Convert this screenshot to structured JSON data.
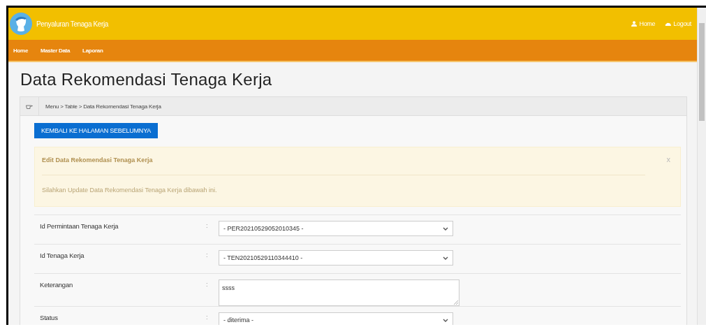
{
  "header": {
    "title": "Penyaluran Tenaga Kerja",
    "links": [
      {
        "label": "Home"
      },
      {
        "label": "Logout"
      }
    ]
  },
  "nav": {
    "items": [
      "Home",
      "Master Data",
      "Laporan"
    ]
  },
  "page_title": "Data Rekomendasi Tenaga Kerja",
  "breadcrumb": "Menu > Table > Data Rekomendasi Tenaga Kerja",
  "back_button": "KEMBALI KE HALAMAN SEBELUMNYA",
  "alert": {
    "title": "Edit Data Rekomendasi Tenaga Kerja",
    "message": "Silahkan Update Data Rekomendasi Tenaga Kerja dibawah ini.",
    "close": "x"
  },
  "form": [
    {
      "label": "Id Permintaan Tenaga Kerja",
      "separator": ":",
      "kind": "select",
      "value": "- PER20210529052010345 -"
    },
    {
      "label": "Id Tenaga Kerja",
      "separator": ":",
      "kind": "select",
      "value": "- TEN20210529110344410 -"
    },
    {
      "label": "Keterangan",
      "separator": ":",
      "kind": "textarea",
      "value": "ssss"
    },
    {
      "label": "Status",
      "separator": ":",
      "kind": "select",
      "value": "- diterima -"
    }
  ]
}
